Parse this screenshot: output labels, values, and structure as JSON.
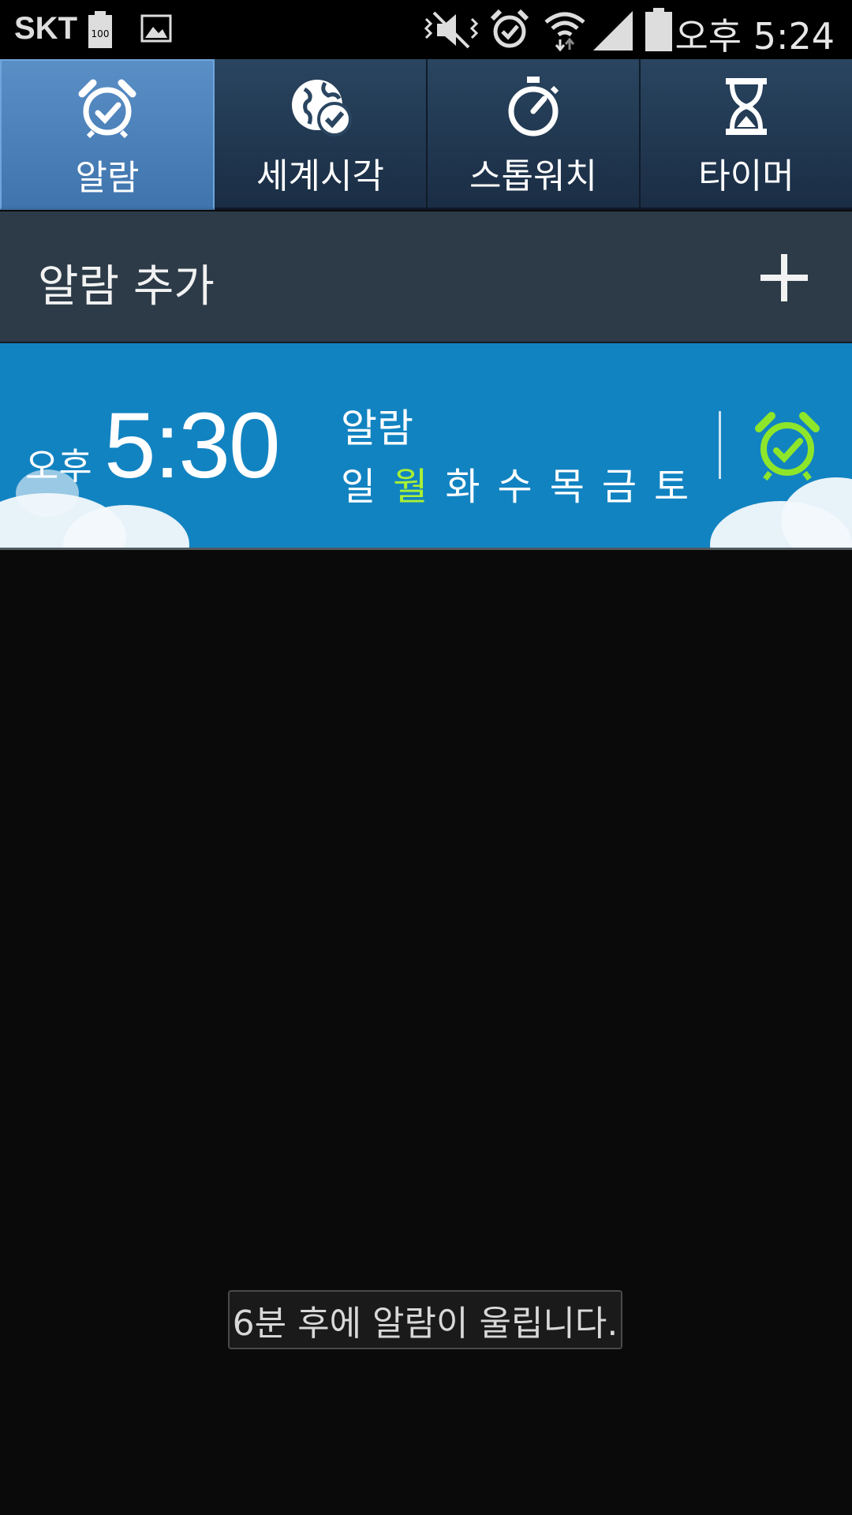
{
  "status_bar": {
    "carrier": "SKT",
    "battery_level_label": "100",
    "clock": "오후 5:24",
    "icons": [
      "battery-icon",
      "gallery-icon",
      "mute-icon",
      "alarm-icon",
      "wifi-icon",
      "signal-icon",
      "battery-icon"
    ]
  },
  "tabs": [
    {
      "label": "알람",
      "icon": "alarm-clock-icon",
      "active": true
    },
    {
      "label": "세계시각",
      "icon": "world-clock-icon",
      "active": false
    },
    {
      "label": "스톱워치",
      "icon": "stopwatch-icon",
      "active": false
    },
    {
      "label": "타이머",
      "icon": "hourglass-icon",
      "active": false
    }
  ],
  "add_alarm": {
    "label": "알람 추가",
    "icon": "plus-icon"
  },
  "alarms": [
    {
      "ampm": "오후",
      "time": "5:30",
      "name": "알람",
      "days": [
        "일",
        "월",
        "화",
        "수",
        "목",
        "금",
        "토"
      ],
      "active_days": [
        "월"
      ],
      "enabled": true,
      "toggle_icon": "alarm-on-icon"
    }
  ],
  "toast": "6분 후에 알람이 울립니다.",
  "colors": {
    "active_tab": "#4a80b8",
    "card_bg": "#1283c1",
    "active_day": "#a9f034",
    "alarm_on_icon": "#8ee62a"
  }
}
